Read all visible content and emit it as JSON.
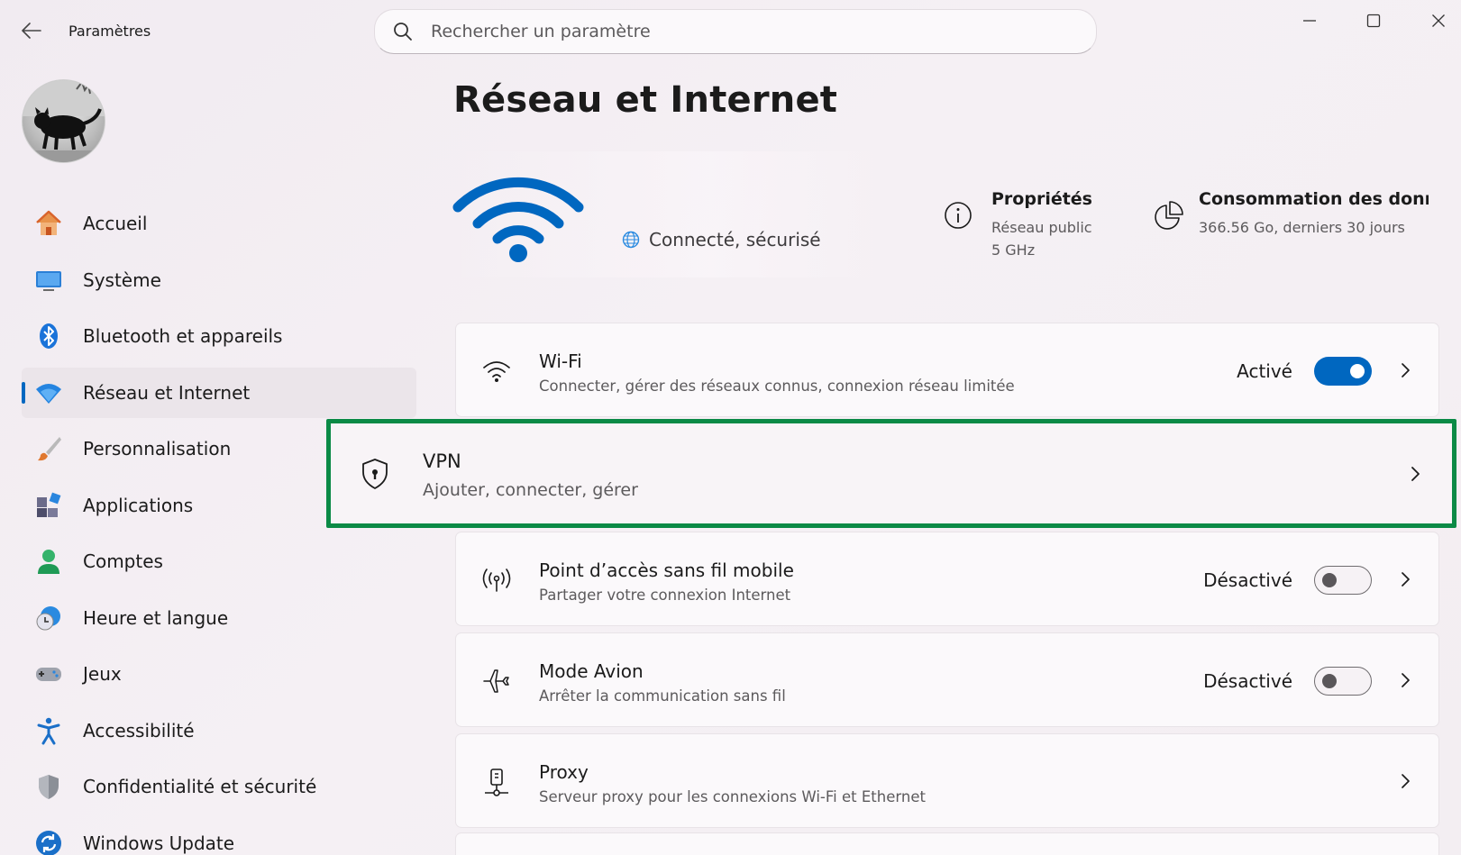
{
  "window": {
    "app_title": "Paramètres",
    "accent_color": "#0067c0",
    "highlight_color": "#0b8a46"
  },
  "search": {
    "placeholder": "Rechercher un paramètre"
  },
  "sidebar": {
    "items": [
      {
        "label": "Accueil",
        "icon": "home-icon"
      },
      {
        "label": "Système",
        "icon": "system-icon"
      },
      {
        "label": "Bluetooth et appareils",
        "icon": "bluetooth-icon"
      },
      {
        "label": "Réseau et Internet",
        "icon": "network-icon",
        "selected": true
      },
      {
        "label": "Personnalisation",
        "icon": "brush-icon"
      },
      {
        "label": "Applications",
        "icon": "apps-icon"
      },
      {
        "label": "Comptes",
        "icon": "account-icon"
      },
      {
        "label": "Heure et langue",
        "icon": "time-language-icon"
      },
      {
        "label": "Jeux",
        "icon": "gamepad-icon"
      },
      {
        "label": "Accessibilité",
        "icon": "accessibility-icon"
      },
      {
        "label": "Confidentialité et sécurité",
        "icon": "shield-icon"
      },
      {
        "label": "Windows Update",
        "icon": "update-icon"
      }
    ]
  },
  "main": {
    "title": "Réseau et Internet",
    "status": {
      "text": "Connecté, sécurisé"
    },
    "properties": {
      "title": "Propriétés",
      "line1": "Réseau public",
      "line2": "5 GHz"
    },
    "usage": {
      "title": "Consommation des données",
      "sub": "366.56 Go, derniers 30 jours"
    },
    "cards": [
      {
        "title": "Wi-Fi",
        "sub": "Connecter, gérer des réseaux connus, connexion réseau limitée",
        "state": "Activé",
        "toggle": "on",
        "icon": "wifi-icon"
      },
      {
        "title": "VPN",
        "sub": "Ajouter, connecter, gérer",
        "icon": "vpn-shield-icon"
      },
      {
        "title": "Point d’accès sans fil mobile",
        "sub": "Partager votre connexion Internet",
        "state": "Désactivé",
        "toggle": "off",
        "icon": "hotspot-icon"
      },
      {
        "title": "Mode Avion",
        "sub": "Arrêter la communication sans fil",
        "state": "Désactivé",
        "toggle": "off",
        "icon": "airplane-icon"
      },
      {
        "title": "Proxy",
        "sub": "Serveur proxy pour les connexions Wi-Fi et Ethernet",
        "icon": "proxy-icon"
      }
    ]
  }
}
